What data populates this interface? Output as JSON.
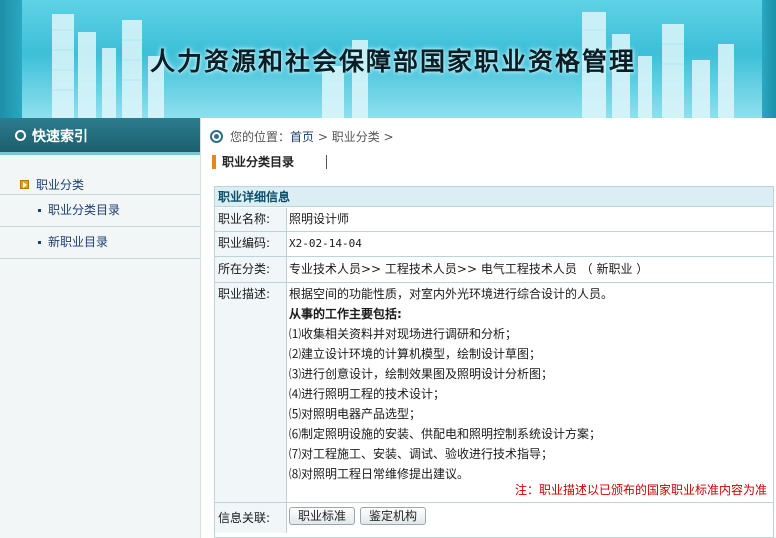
{
  "banner": {
    "title": "人力资源和社会保障部国家职业资格管理"
  },
  "sidebar": {
    "header": "快速索引",
    "category": "职业分类",
    "items": [
      {
        "label": "职业分类目录"
      },
      {
        "label": "新职业目录"
      }
    ]
  },
  "breadcrumb": {
    "prefix": "您的位置：",
    "home": "首页",
    "sep1": " > ",
    "current": "职业分类",
    "sep2": " >"
  },
  "section": {
    "title": "职业分类目录"
  },
  "detail": {
    "header": "职业详细信息",
    "name_label": "职业名称:",
    "name_value": "照明设计师",
    "code_label": "职业编码:",
    "code_value": "X2-02-14-04",
    "category_label": "所在分类:",
    "category_value": "专业技术人员>> 工程技术人员>> 电气工程技术人员 （ 新职业 ）",
    "desc_label": "职业描述:",
    "desc_summary": "根据空间的功能性质，对室内外光环境进行综合设计的人员。",
    "duties_heading": "从事的工作主要包括:",
    "duties": [
      "⑴收集相关资料并对现场进行调研和分析；",
      "⑵建立设计环境的计算机模型，绘制设计草图；",
      "⑶进行创意设计，绘制效果图及照明设计分析图；",
      "⑷进行照明工程的技术设计；",
      "⑸对照明电器产品选型；",
      "⑹制定照明设施的安装、供配电和照明控制系统设计方案；",
      "⑺对工程施工、安装、调试、验收进行技术指导；",
      "⑻对照明工程日常维修提出建议。"
    ],
    "note": "注：职业描述以已颁布的国家职业标准内容为准",
    "related_label": "信息关联:",
    "buttons": {
      "standard": "职业标准",
      "agency": "鉴定机构"
    }
  }
}
